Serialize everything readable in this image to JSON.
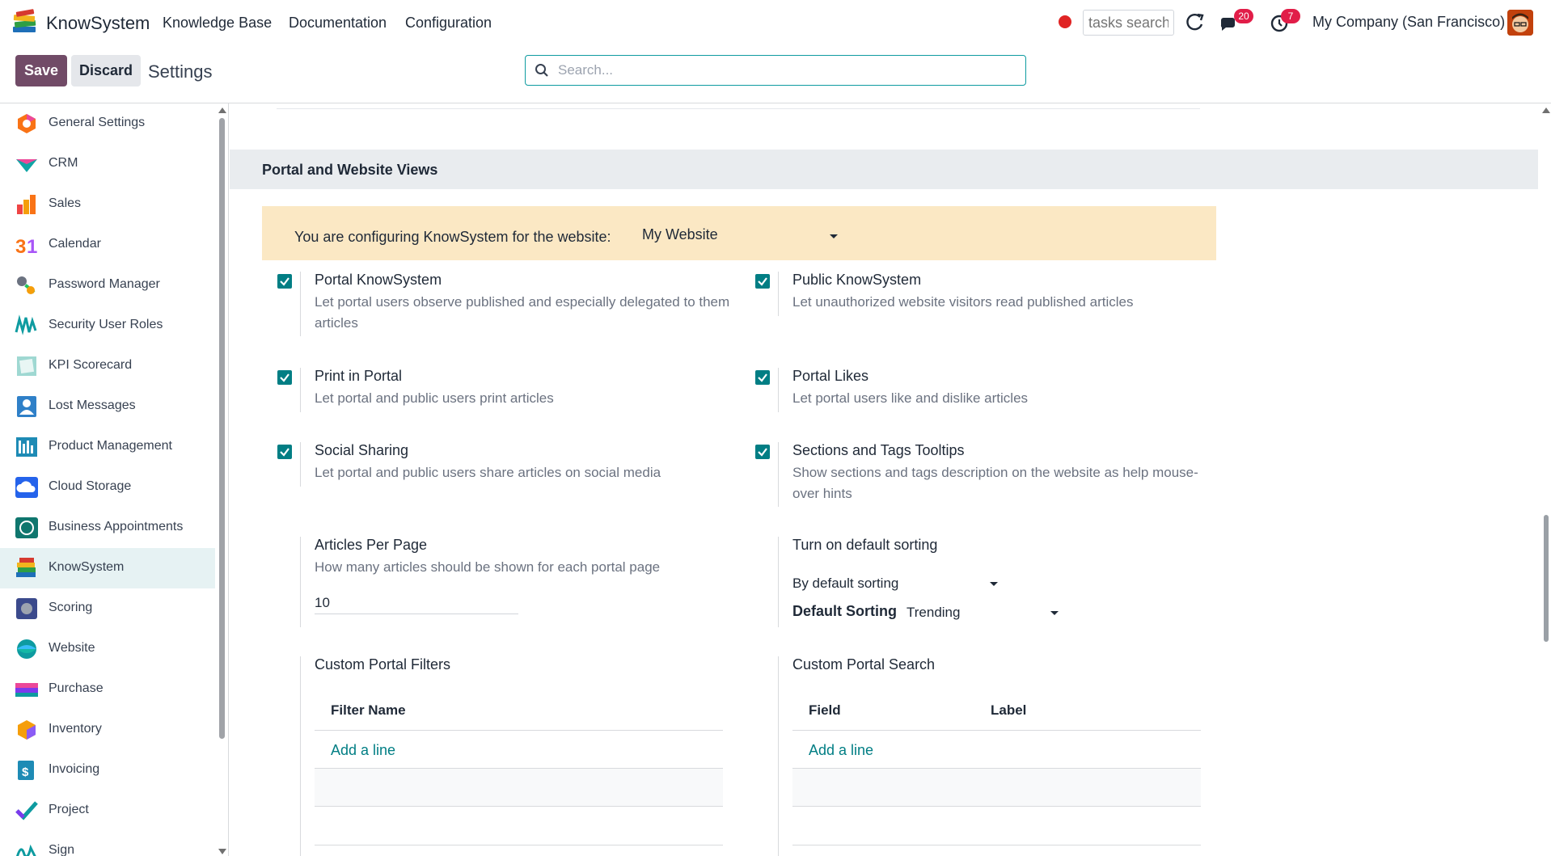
{
  "topnav": {
    "app_name": "KnowSystem",
    "menu": [
      "Knowledge Base",
      "Documentation",
      "Configuration"
    ],
    "tasks_search_placeholder": "tasks search",
    "messages_badge": "20",
    "activities_badge": "7",
    "company": "My Company (San Francisco)"
  },
  "control": {
    "save_label": "Save",
    "discard_label": "Discard",
    "breadcrumb": "Settings",
    "search_placeholder": "Search..."
  },
  "sidebar": {
    "items": [
      {
        "label": "General Settings",
        "icon": "general-settings-icon"
      },
      {
        "label": "CRM",
        "icon": "crm-icon"
      },
      {
        "label": "Sales",
        "icon": "sales-icon"
      },
      {
        "label": "Calendar",
        "icon": "calendar-icon"
      },
      {
        "label": "Password Manager",
        "icon": "password-manager-icon"
      },
      {
        "label": "Security User Roles",
        "icon": "security-user-roles-icon"
      },
      {
        "label": "KPI Scorecard",
        "icon": "kpi-scorecard-icon"
      },
      {
        "label": "Lost Messages",
        "icon": "lost-messages-icon"
      },
      {
        "label": "Product Management",
        "icon": "product-management-icon"
      },
      {
        "label": "Cloud Storage",
        "icon": "cloud-storage-icon"
      },
      {
        "label": "Business Appointments",
        "icon": "business-appointments-icon"
      },
      {
        "label": "KnowSystem",
        "icon": "knowsystem-icon"
      },
      {
        "label": "Scoring",
        "icon": "scoring-icon"
      },
      {
        "label": "Website",
        "icon": "website-icon"
      },
      {
        "label": "Purchase",
        "icon": "purchase-icon"
      },
      {
        "label": "Inventory",
        "icon": "inventory-icon"
      },
      {
        "label": "Invoicing",
        "icon": "invoicing-icon"
      },
      {
        "label": "Project",
        "icon": "project-icon"
      },
      {
        "label": "Sign",
        "icon": "sign-icon"
      }
    ],
    "active": "KnowSystem"
  },
  "section": {
    "title": "Portal and Website Views",
    "alert_text": "You are configuring KnowSystem for the website:",
    "website": "My Website"
  },
  "settings": {
    "portal_knowsystem": {
      "title": "Portal KnowSystem",
      "desc": "Let portal users observe published and especially delegated to them articles",
      "checked": true
    },
    "public_knowsystem": {
      "title": "Public KnowSystem",
      "desc": "Let unauthorized website visitors read published articles",
      "checked": true
    },
    "print_in_portal": {
      "title": "Print in Portal",
      "desc": "Let portal and public users print articles",
      "checked": true
    },
    "portal_likes": {
      "title": "Portal Likes",
      "desc": "Let portal users like and dislike articles",
      "checked": true
    },
    "social_sharing": {
      "title": "Social Sharing",
      "desc": "Let portal and public users share articles on social media",
      "checked": true
    },
    "sections_tooltips": {
      "title": "Sections and Tags Tooltips",
      "desc": "Show sections and tags description on the website as help mouse-over hints",
      "checked": true
    },
    "articles_per_page": {
      "title": "Articles Per Page",
      "desc": "How many articles should be shown for each portal page",
      "value": "10"
    },
    "default_sorting": {
      "title": "Turn on default sorting",
      "value": "By default sorting",
      "sorting_label": "Default Sorting",
      "sorting_value": "Trending"
    },
    "custom_filters": {
      "title": "Custom Portal Filters",
      "columns": [
        "Filter Name"
      ],
      "add_line": "Add a line"
    },
    "custom_search": {
      "title": "Custom Portal Search",
      "columns": [
        "Field",
        "Label"
      ],
      "add_line": "Add a line"
    }
  }
}
